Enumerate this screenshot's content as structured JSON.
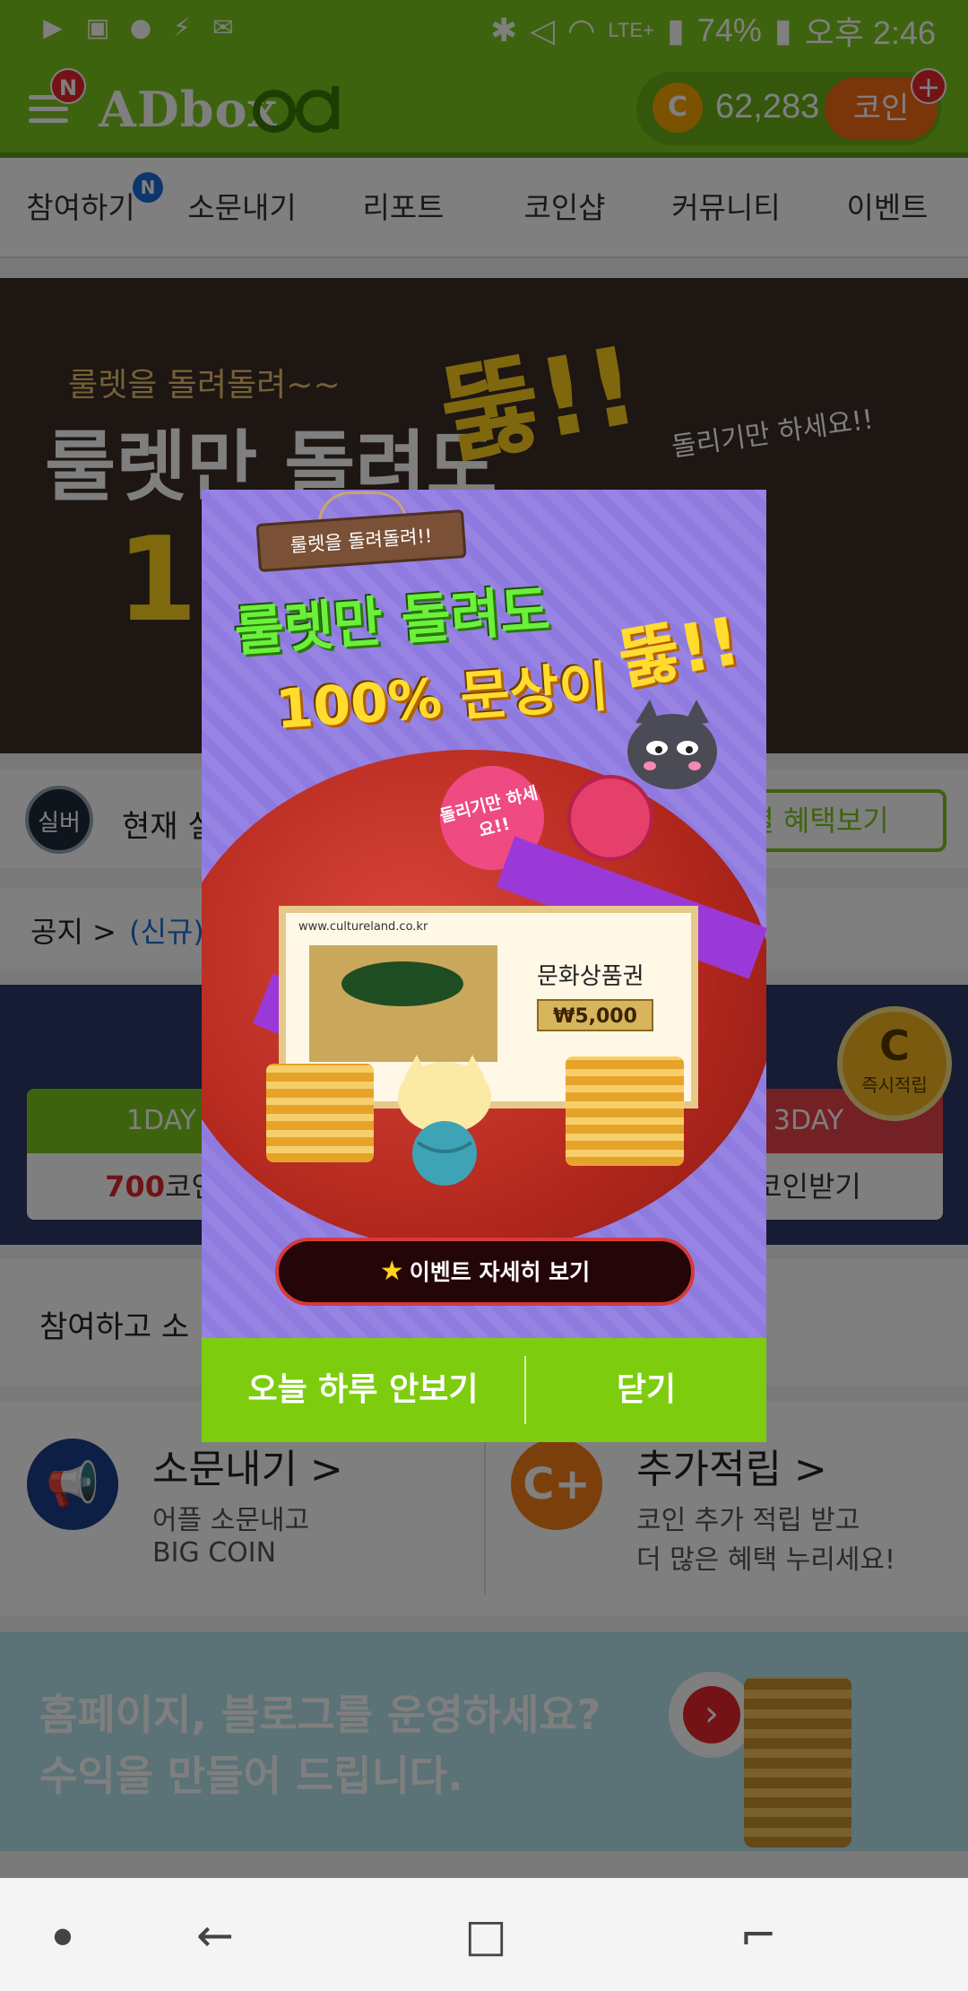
{
  "status_bar": {
    "battery": "74%",
    "time": "오후 2:46",
    "network": "LTE+",
    "icons": [
      "youtube-icon",
      "gallery-icon",
      "kakaotalk-icon",
      "flash-icon",
      "mail-icon",
      "bluetooth-icon",
      "mute-icon",
      "wifi-icon",
      "signal-icon",
      "battery-icon"
    ]
  },
  "app_header": {
    "logo": "ADbox",
    "menu_badge": "N",
    "coin_symbol": "C",
    "coin_balance": "62,283",
    "coin_button": "코인",
    "coin_plus": "+",
    "colors": {
      "brand": "#7cc61c",
      "accent": "#f76b17",
      "badge": "#e8262d"
    }
  },
  "nav": {
    "tabs": [
      "참여하기",
      "소문내기",
      "리포트",
      "코인샵",
      "커뮤니티",
      "이벤트"
    ],
    "badge": "N"
  },
  "banner": {
    "subtitle": "룰렛을 돌려돌려~~",
    "title": "룰렛만 돌려도",
    "exclaim": "뚫!!",
    "percent": "100",
    "side_text": "돌리기만 하세요!!"
  },
  "grade": {
    "icon_label": "실버",
    "text": "현재 실",
    "button": "별 혜택보기"
  },
  "notice": {
    "label": "공지 >",
    "item": "(신규)"
  },
  "attendance": {
    "cards": [
      {
        "header": "1DAY",
        "amount": "700",
        "suffix": "코인"
      },
      {
        "header": "3DAY",
        "amount": "",
        "suffix": "코인받기"
      }
    ],
    "instant_badge": {
      "symbol": "C",
      "label": "즉시적립"
    }
  },
  "join_strip": {
    "text": "참여하고 소"
  },
  "features": [
    {
      "icon": "megaphone-icon",
      "title": "소문내기 >",
      "line1": "어플 소문내고",
      "line2": "BIG COIN"
    },
    {
      "icon": "coin-plus-icon",
      "title": "추가적립 >",
      "line1": "코인 추가 적립 받고",
      "line2": "더 많은 혜택 누리세요!"
    }
  ],
  "promo": {
    "line1": "홈페이지, 블로그를 운영하세요?",
    "line2": "수익을 만들어 드립니다."
  },
  "popup": {
    "sign": "룰렛을 돌려돌려!!",
    "headline1": "룰렛만 돌려도",
    "headline2": "100% 문상이",
    "headline3": "뚫!!",
    "bubble": "돌리기만 하세요!!",
    "voucher": {
      "url": "www.cultureland.co.kr",
      "title": "문화상품권",
      "amount": "₩5,000"
    },
    "event_button": "이벤트 자세히 보기",
    "hide_today_button": "오늘 하루 안보기",
    "close_button": "닫기"
  },
  "system_nav": {
    "buttons": [
      "dot-icon",
      "back-icon",
      "home-icon",
      "recents-icon"
    ]
  }
}
